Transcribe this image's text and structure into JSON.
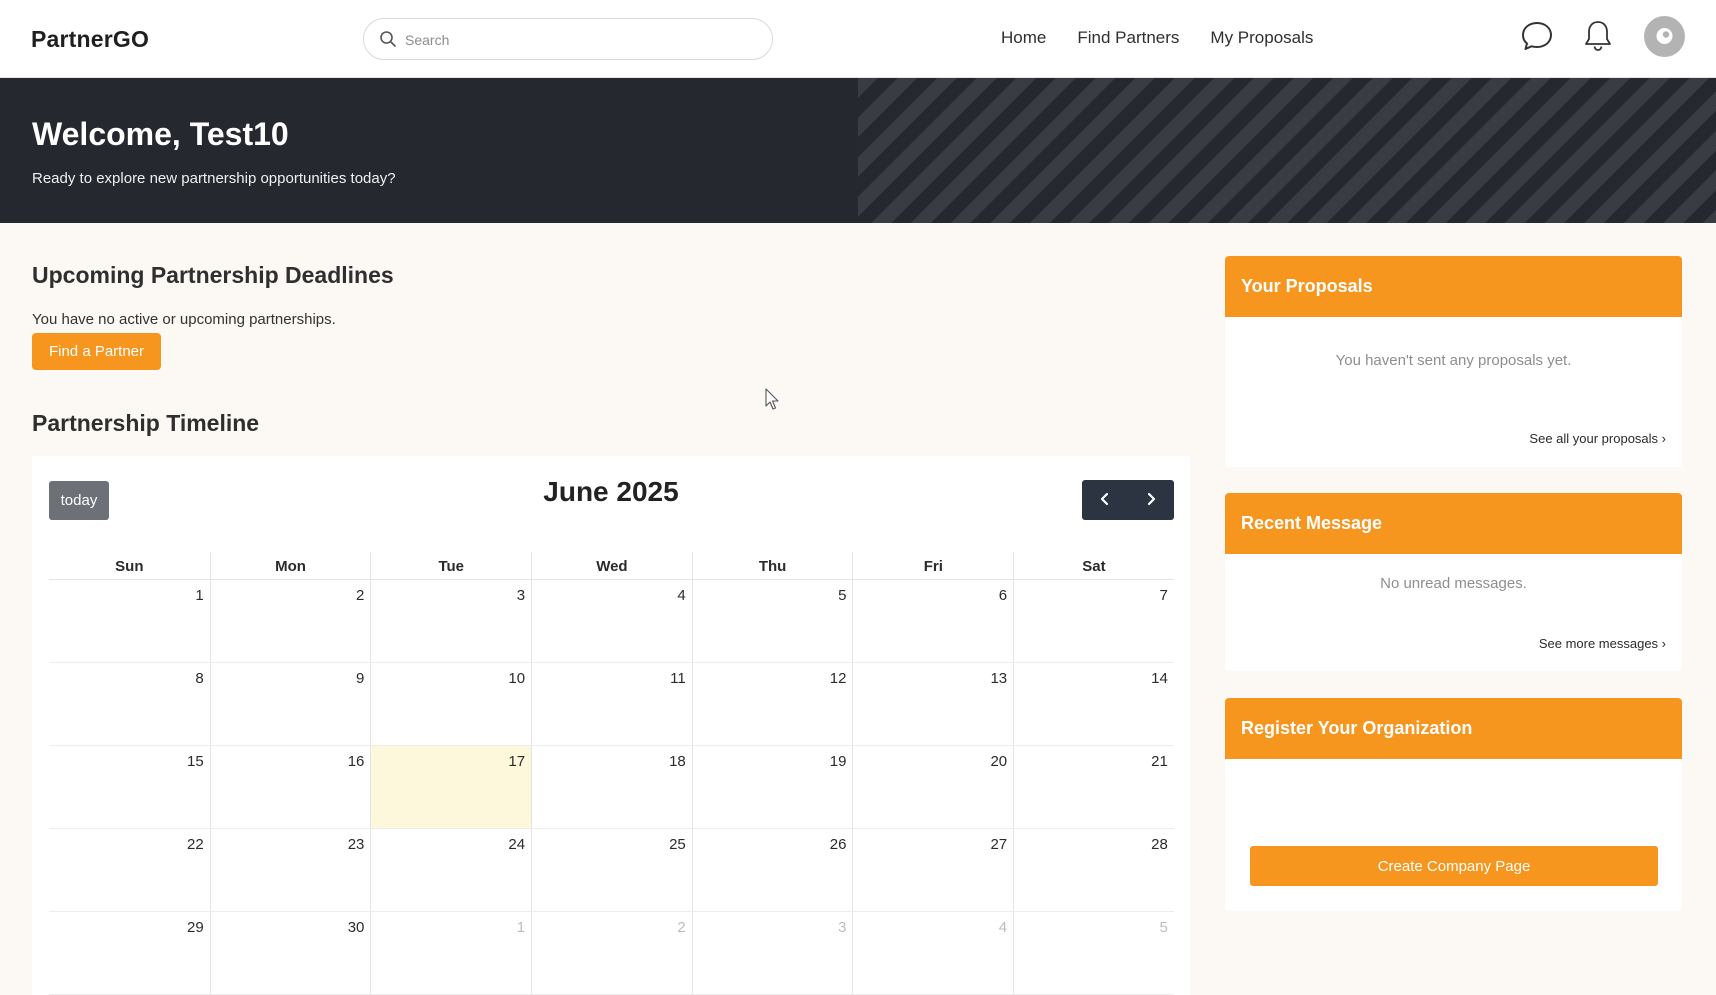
{
  "nav": {
    "brand": "PartnerGO",
    "search_placeholder": "Search",
    "links": [
      "Home",
      "Find Partners",
      "My Proposals"
    ],
    "icons": [
      "chat-bubble-icon",
      "bell-icon",
      "avatar"
    ]
  },
  "hero": {
    "title": "Welcome, Test10",
    "subtitle": "Ready to explore new partnership opportunities today?"
  },
  "deadlines": {
    "title": "Upcoming Partnership Deadlines",
    "empty_text": "You have no active or upcoming partnerships.",
    "button_label": "Find a Partner"
  },
  "timeline": {
    "title": "Partnership Timeline",
    "today_label": "today",
    "month_label": "June 2025",
    "weekdays": [
      "Sun",
      "Mon",
      "Tue",
      "Wed",
      "Thu",
      "Fri",
      "Sat"
    ],
    "weeks": [
      [
        "1",
        "2",
        "3",
        "4",
        "5",
        "6",
        "7"
      ],
      [
        "8",
        "9",
        "10",
        "11",
        "12",
        "13",
        "14"
      ],
      [
        "15",
        "16",
        "17",
        "18",
        "19",
        "20",
        "21"
      ],
      [
        "22",
        "23",
        "24",
        "25",
        "26",
        "27",
        "28"
      ],
      [
        "29",
        "30",
        "1",
        "2",
        "3",
        "4",
        "5"
      ]
    ],
    "today_date": "17",
    "highlight_color": "#fdf7dc"
  },
  "proposals_card": {
    "title": "Your Proposals",
    "empty_text": "You haven't sent any proposals yet.",
    "link": "See all your proposals ›"
  },
  "messages_card": {
    "title": "Recent Message",
    "empty_text": "No unread messages.",
    "link": "See more messages ›"
  },
  "register_card": {
    "title": "Register Your Organization",
    "button_label": "Create Company Page"
  },
  "colors": {
    "accent": "#f7961f",
    "hero_bg": "#262830",
    "nav_button_bg": "#2b3440"
  }
}
